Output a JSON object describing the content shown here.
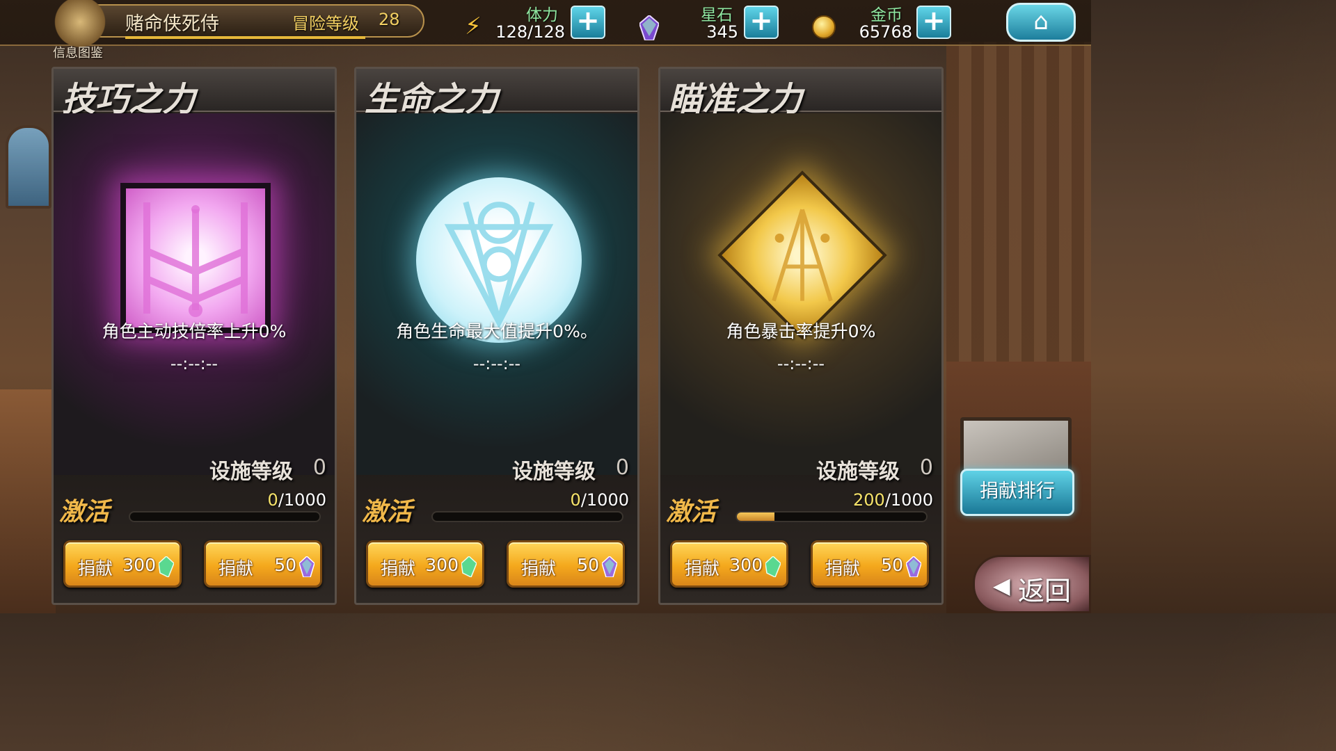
{
  "player": {
    "name": "赌命侠死侍",
    "adventure_label": "冒险等级",
    "adventure_level": "28",
    "info_label": "信息图鉴"
  },
  "resources": {
    "stamina": {
      "label": "体力",
      "value": "128/128",
      "add_label": "+"
    },
    "starstone": {
      "label": "星石",
      "value": "345",
      "add_label": "+"
    },
    "gold": {
      "label": "金币",
      "value": "65768",
      "add_label": "+"
    }
  },
  "cards": [
    {
      "title": "技巧之力",
      "description": "角色主动技倍率上升0%",
      "timer": "--:--:--",
      "facility_label": "设施等级",
      "facility_level": "0",
      "activate_label": "激活",
      "progress_current": "0",
      "progress_total": "/1000",
      "progress_fraction": 0,
      "theme": "#e05ad8",
      "buttons": [
        {
          "label": "捐献",
          "amount": "300",
          "gem": "green-crystal-icon"
        },
        {
          "label": "捐献",
          "amount": "50",
          "gem": "rainbow-crystal-icon"
        }
      ]
    },
    {
      "title": "生命之力",
      "description": "角色生命最大值提升0%。",
      "timer": "--:--:--",
      "facility_label": "设施等级",
      "facility_level": "0",
      "activate_label": "激活",
      "progress_current": "0",
      "progress_total": "/1000",
      "progress_fraction": 0,
      "theme": "#7ed4e8",
      "buttons": [
        {
          "label": "捐献",
          "amount": "300",
          "gem": "green-crystal-icon"
        },
        {
          "label": "捐献",
          "amount": "50",
          "gem": "rainbow-crystal-icon"
        }
      ]
    },
    {
      "title": "瞄准之力",
      "description": "角色暴击率提升0%",
      "timer": "--:--:--",
      "facility_label": "设施等级",
      "facility_level": "0",
      "activate_label": "激活",
      "progress_current": "200",
      "progress_total": "/1000",
      "progress_fraction": 0.2,
      "theme": "#f2c84a",
      "buttons": [
        {
          "label": "捐献",
          "amount": "300",
          "gem": "green-crystal-icon"
        },
        {
          "label": "捐献",
          "amount": "50",
          "gem": "rainbow-crystal-icon"
        }
      ]
    }
  ],
  "rank_button": "捐献排行",
  "back_button": "返回",
  "home_button": "home-icon"
}
